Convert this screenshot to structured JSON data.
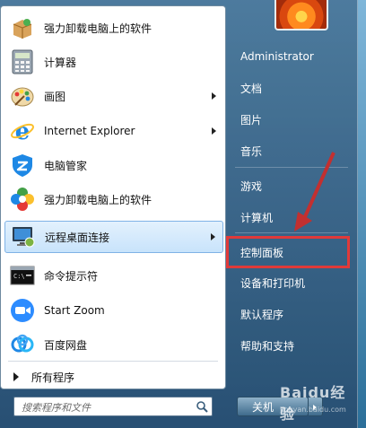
{
  "left_menu": {
    "items": [
      {
        "label": "强力卸载电脑上的软件",
        "icon": "uninstall-box-icon"
      },
      {
        "label": "计算器",
        "icon": "calculator-icon"
      },
      {
        "label": "画图",
        "icon": "paint-palette-icon"
      },
      {
        "label": "Internet Explorer",
        "icon": "internet-explorer-icon"
      },
      {
        "label": "电脑管家",
        "icon": "shield-icon"
      },
      {
        "label": "强力卸载电脑上的软件",
        "icon": "colorful-flower-icon"
      },
      {
        "label": "远程桌面连接",
        "icon": "remote-desktop-icon"
      },
      {
        "label": "命令提示符",
        "icon": "command-prompt-icon"
      },
      {
        "label": "Start Zoom",
        "icon": "zoom-camera-icon"
      },
      {
        "label": "百度网盘",
        "icon": "cloud-disk-icon"
      }
    ],
    "all_programs": "所有程序",
    "search_placeholder": "搜索程序和文件"
  },
  "right_menu": {
    "items": [
      {
        "label": "Administrator"
      },
      {
        "label": "文档"
      },
      {
        "label": "图片"
      },
      {
        "label": "音乐"
      },
      {
        "label": "游戏"
      },
      {
        "label": "计算机"
      },
      {
        "label": "控制面板"
      },
      {
        "label": "设备和打印机"
      },
      {
        "label": "默认程序"
      },
      {
        "label": "帮助和支持"
      }
    ],
    "shutdown_label": "关机"
  },
  "watermark": {
    "main": "Baidu经验",
    "sub": "jingyan.baidu.com"
  },
  "colors": {
    "highlight": "#e03a3a",
    "arrow": "#c23030"
  }
}
